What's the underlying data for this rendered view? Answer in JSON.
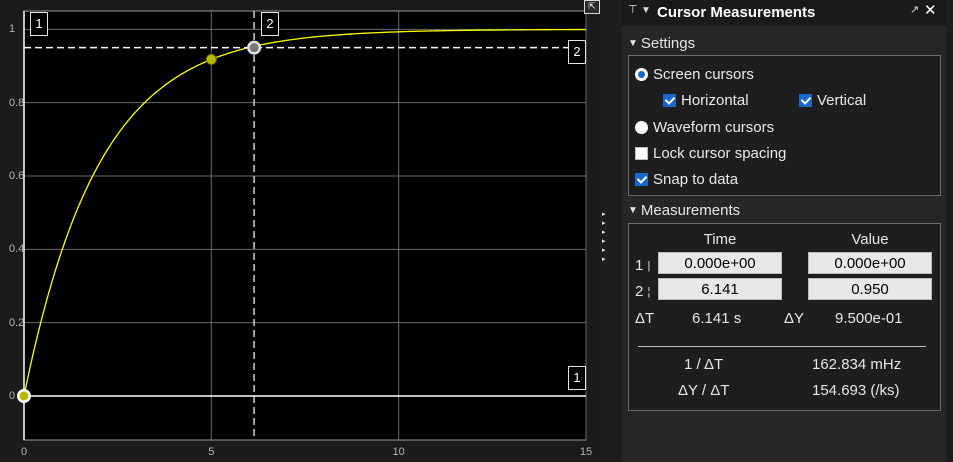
{
  "chart_data": {
    "type": "line",
    "xlim": [
      0,
      15
    ],
    "ylim": [
      -0.12,
      1.05
    ],
    "x_ticks": [
      0,
      5,
      10,
      15
    ],
    "y_ticks": [
      0.2,
      0.4,
      0.6,
      0.8,
      1
    ],
    "x_tick_labels": [
      "0",
      "5",
      "10",
      "15"
    ],
    "y_tick_labels": [
      "0.2",
      "0.4",
      "0.6",
      "0.8",
      "1"
    ],
    "y_zero_label": "0",
    "grid": true,
    "series": [
      {
        "color": "#ffff00",
        "function": "1 - exp(-t/2)",
        "x": [
          0,
          0.5,
          1,
          1.5,
          2,
          3,
          4,
          5,
          6,
          6.141,
          7,
          8,
          9,
          10,
          12,
          15
        ],
        "y": [
          0,
          0.221,
          0.393,
          0.528,
          0.632,
          0.777,
          0.865,
          0.918,
          0.95,
          0.954,
          0.97,
          0.982,
          0.989,
          0.993,
          0.998,
          1.0
        ]
      }
    ],
    "markers": [
      {
        "x": 5,
        "y": 0.918,
        "style": "data-point"
      },
      {
        "x": 0,
        "y": 0.0,
        "style": "cursor-1"
      },
      {
        "x": 6.141,
        "y": 0.95,
        "style": "cursor-2"
      }
    ],
    "cursors": {
      "vertical_1_x": 0,
      "vertical_2_x": 6.141,
      "horizontal_1_y": 0.0,
      "horizontal_2_y": 0.95
    },
    "cursor_badges": {
      "v1": "1",
      "v2": "2",
      "h1": "1",
      "h2": "2"
    },
    "colors": {
      "background": "#000000",
      "grid": "#6b6b6b",
      "line": "#ffff00",
      "cursor": "#ffffff"
    }
  },
  "panel": {
    "title": "Cursor Measurements",
    "settings": {
      "label": "Settings",
      "screen_cursors": {
        "label": "Screen cursors",
        "selected": true
      },
      "horizontal": {
        "label": "Horizontal",
        "checked": true
      },
      "vertical": {
        "label": "Vertical",
        "checked": true
      },
      "waveform_cursors": {
        "label": "Waveform cursors",
        "selected": false
      },
      "lock_spacing": {
        "label": "Lock cursor spacing",
        "checked": false
      },
      "snap_to_data": {
        "label": "Snap to data",
        "checked": true
      }
    },
    "measurements": {
      "label": "Measurements",
      "col_time": "Time",
      "col_value": "Value",
      "rows": [
        {
          "label": "1",
          "time": "0.000e+00",
          "value": "0.000e+00"
        },
        {
          "label": "2",
          "time": "6.141",
          "value": "0.950"
        }
      ],
      "delta_t_label": "ΔT",
      "delta_t_value": "6.141 s",
      "delta_y_label": "ΔY",
      "delta_y_value": "9.500e-01",
      "inv_dt_label": "1 / ΔT",
      "inv_dt_value": "162.834 mHz",
      "dy_dt_label": "ΔY / ΔT",
      "dy_dt_value": "154.693 (/ks)"
    }
  },
  "icons": {
    "pin": "pin-icon",
    "menu": "menu-arrow-icon",
    "dock": "undock-icon",
    "close": "close-icon",
    "undock_plot": "undock-plot-icon",
    "collapse": "collapse-arrows-icon"
  },
  "glyphs": {
    "close": "✕",
    "pin": "⊤",
    "menu": "▼",
    "dock": "↗",
    "undock": "⇱",
    "tri": "▼",
    "arrows": "◀◀◀◀◀◀"
  }
}
